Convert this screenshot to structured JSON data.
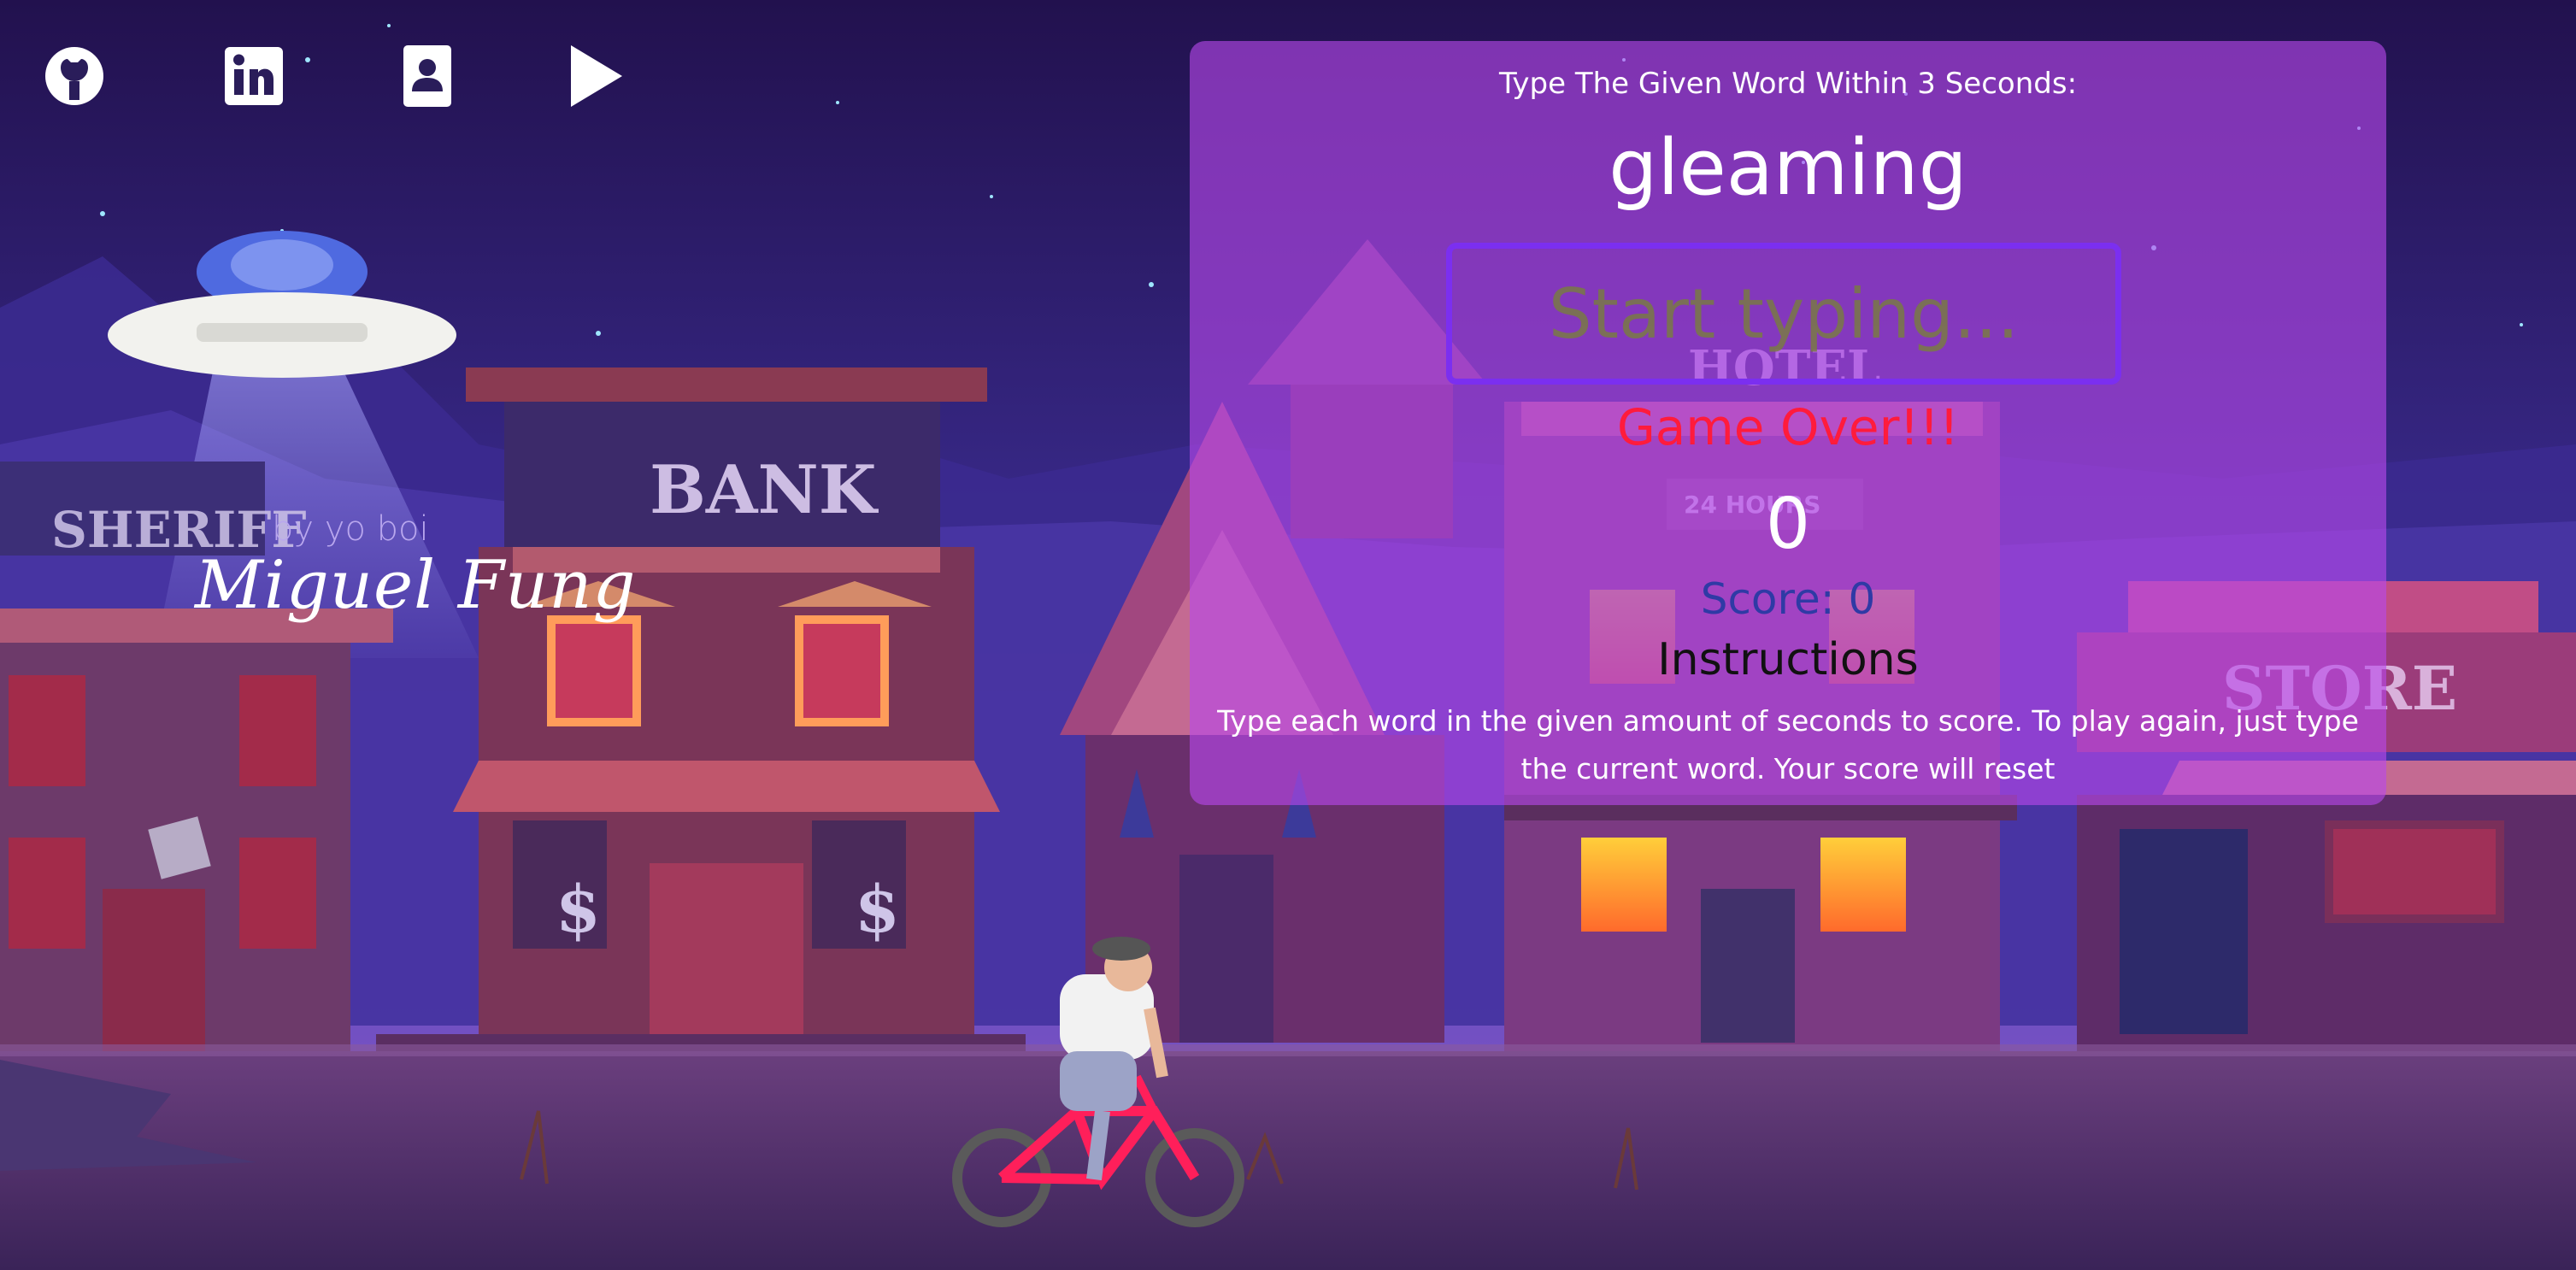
{
  "nav": {
    "icons": [
      "github-icon",
      "linkedin-icon",
      "contact-card-icon",
      "play-icon"
    ]
  },
  "scene": {
    "signs": {
      "sheriff": "SHERIFF",
      "bank": "BANK",
      "hotel": "HOTEL",
      "hours": "24 HOURS",
      "store": "STORE",
      "dollar": "$"
    }
  },
  "credit": {
    "by": "by yo boi",
    "name": "Miguel Fung"
  },
  "game": {
    "prompt": "Type The Given Word Within 3 Seconds:",
    "current_word": "gleaming",
    "input_placeholder": "Start typing...",
    "message": "Game Over!!!",
    "seconds_left": "0",
    "score_text": "Score: 0",
    "instructions_title": "Instructions",
    "instructions_text": "Type each word in the given amount of seconds to score. To play again, just type the current word. Your score will reset"
  },
  "colors": {
    "panel": "#b848ec",
    "game_over": "#ff1b3c",
    "score": "#2f3aa5",
    "input_border": "#7b2ff0",
    "sky_top": "#23124f",
    "sky_bottom": "#5a3aa8"
  }
}
